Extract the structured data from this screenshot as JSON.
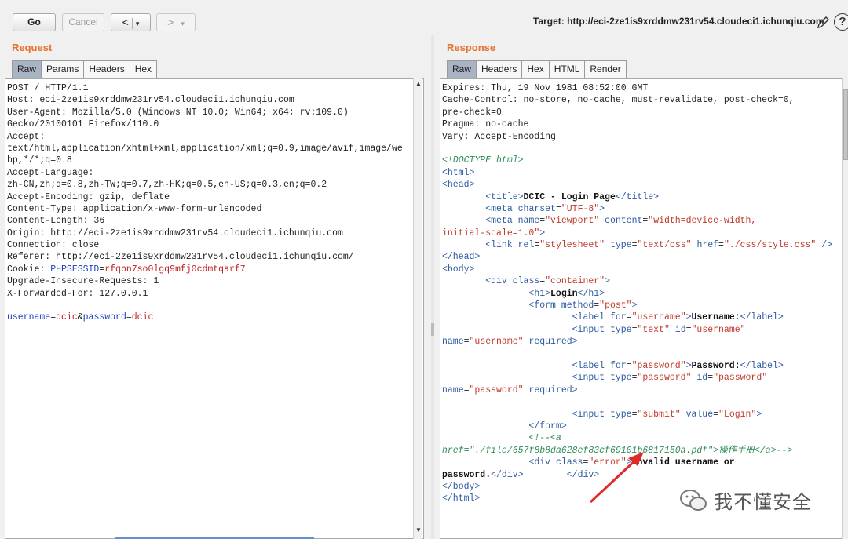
{
  "toolbar": {
    "go_label": "Go",
    "cancel_label": "Cancel",
    "back_arrow": "<",
    "forward_arrow": ">",
    "caret": "▾",
    "target_label": "Target: http://eci-2ze1is9xrddmw231rv54.cloudeci1.ichunqiu.com",
    "help_label": "?"
  },
  "request": {
    "title": "Request",
    "tabs": [
      "Raw",
      "Params",
      "Headers",
      "Hex"
    ],
    "lines": [
      "POST / HTTP/1.1",
      "Host: eci-2ze1is9xrddmw231rv54.cloudeci1.ichunqiu.com",
      "User-Agent: Mozilla/5.0 (Windows NT 10.0; Win64; x64; rv:109.0)",
      "Gecko/20100101 Firefox/110.0",
      "Accept:",
      "text/html,application/xhtml+xml,application/xml;q=0.9,image/avif,image/we",
      "bp,*/*;q=0.8",
      "Accept-Language:",
      "zh-CN,zh;q=0.8,zh-TW;q=0.7,zh-HK;q=0.5,en-US;q=0.3,en;q=0.2",
      "Accept-Encoding: gzip, deflate",
      "Content-Type: application/x-www-form-urlencoded",
      "Content-Length: 36",
      "Origin: http://eci-2ze1is9xrddmw231rv54.cloudeci1.ichunqiu.com",
      "Connection: close",
      "Referer: http://eci-2ze1is9xrddmw231rv54.cloudeci1.ichunqiu.com/",
      "Cookie: ",
      "Upgrade-Insecure-Requests: 1",
      "X-Forwarded-For: 127.0.0.1",
      "",
      ""
    ],
    "cookie_name": "PHPSESSID",
    "cookie_eq": "=",
    "cookie_value": "rfqpn7so0lgq9mfj0cdmtqarf7",
    "body_k1": "username",
    "body_v1": "dcic",
    "body_amp": "&",
    "body_k2": "password",
    "body_v2": "dcic"
  },
  "response": {
    "title": "Response",
    "tabs": [
      "Raw",
      "Headers",
      "Hex",
      "HTML",
      "Render"
    ],
    "headers": [
      "Expires: Thu, 19 Nov 1981 08:52:00 GMT",
      "Cache-Control: no-store, no-cache, must-revalidate, post-check=0,",
      "pre-check=0",
      "Pragma: no-cache",
      "Vary: Accept-Encoding"
    ],
    "doctype": "<!DOCTYPE html>",
    "title_text": "DCIC - Login Page",
    "h1_text": "Login",
    "username_label": "Username:",
    "password_label": "Password:",
    "submit_value": "Login",
    "comment_href": "./file/657f8b8da628ef83cf69101b6817150a.pdf",
    "comment_link_text": "操作手册",
    "error_text_1": "Invalid username or",
    "error_text_2": "password."
  },
  "watermark": {
    "text": "我不懂安全"
  },
  "colors": {
    "accent": "#e8702a",
    "active_tab": "#a8b4c4",
    "annotation_arrow": "#e02a2a"
  }
}
